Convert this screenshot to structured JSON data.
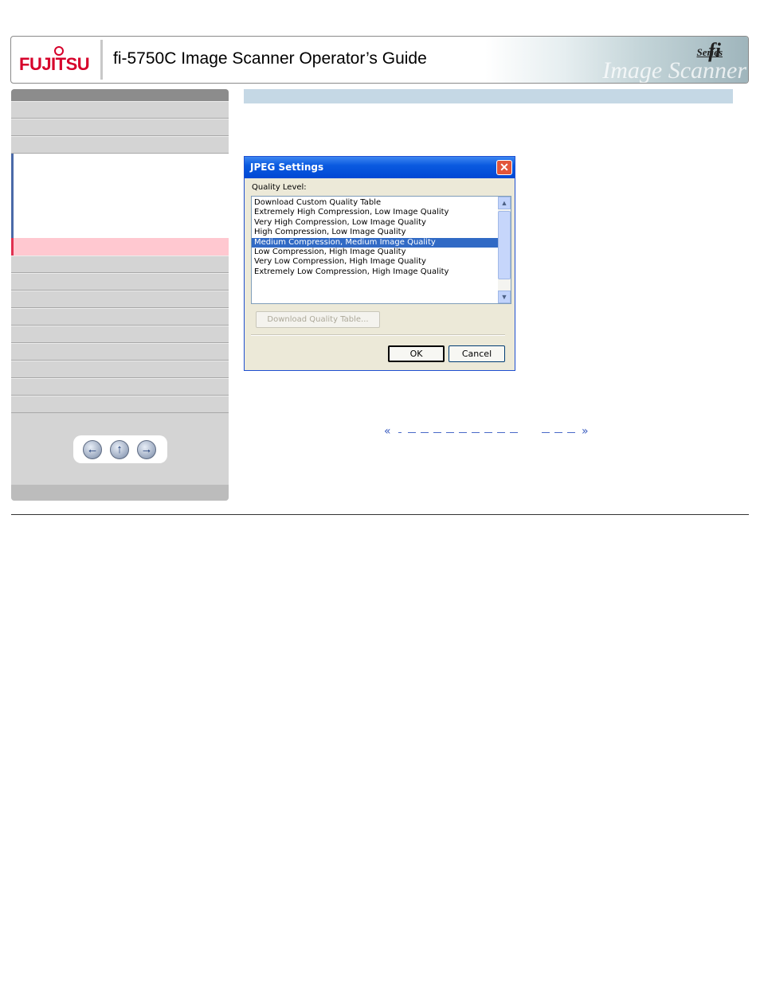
{
  "header": {
    "logo_text": "FUJITSU",
    "title": "fi-5750C Image Scanner Operator’s Guide",
    "brand_fi": "fi",
    "brand_series": "Series",
    "brand_watermark": "Image Scanner"
  },
  "dialog": {
    "title": "JPEG Settings",
    "close_icon": "✕",
    "quality_label": "Quality Level:",
    "options": [
      "Download Custom Quality Table",
      "Extremely High Compression, Low Image Quality",
      "Very High Compression, Low Image Quality",
      "High Compression, Low Image Quality",
      "Medium Compression, Medium Image Quality",
      "Low Compression, High Image Quality",
      "Very Low Compression, High Image Quality",
      "Extremely Low Compression, High Image Quality"
    ],
    "selected_index": 4,
    "download_button": "Download Quality Table...",
    "ok_button": "OK",
    "cancel_button": "Cancel"
  },
  "nav": {
    "back_icon": "←",
    "up_icon": "↑",
    "forward_icon": "→"
  },
  "links": {
    "prev_icon": "«",
    "next_icon": "»"
  }
}
